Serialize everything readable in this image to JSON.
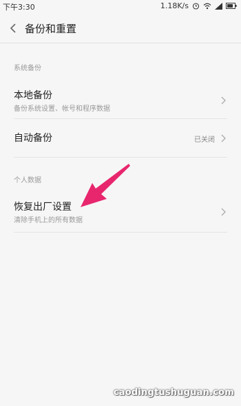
{
  "status_bar": {
    "time": "下午3:30",
    "speed": "1.18K/s"
  },
  "header": {
    "title": "备份和重置"
  },
  "sections": [
    {
      "header": "系统备份",
      "items": [
        {
          "title": "本地备份",
          "subtitle": "备份系统设置、帐号和程序数据"
        },
        {
          "title": "自动备份",
          "value": "已关闭"
        }
      ]
    },
    {
      "header": "个人数据",
      "items": [
        {
          "title": "恢复出厂设置",
          "subtitle": "清除手机上的所有数据"
        }
      ]
    }
  ],
  "annotation": {
    "arrow_color": "#e8266e"
  },
  "watermark": "caodingtushuguan.com"
}
